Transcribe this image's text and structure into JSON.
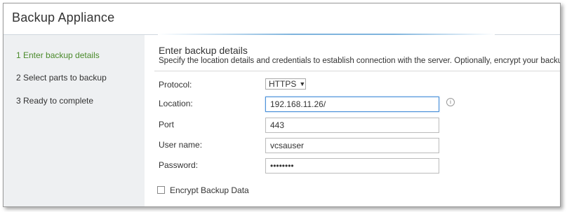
{
  "window": {
    "title": "Backup Appliance"
  },
  "sidebar": {
    "steps": [
      {
        "label": "1 Enter backup details",
        "active": true
      },
      {
        "label": "2 Select parts to backup",
        "active": false
      },
      {
        "label": "3 Ready to complete",
        "active": false
      }
    ]
  },
  "form": {
    "heading": "Enter backup details",
    "description": "Specify the location details and credentials to establish connection with the server. Optionally, encrypt your backup.",
    "protocol": {
      "label": "Protocol:",
      "value": "HTTPS"
    },
    "location": {
      "label": "Location:",
      "value": "192.168.11.26/"
    },
    "port": {
      "label": "Port",
      "value": "443"
    },
    "username": {
      "label": "User name:",
      "value": "vcsauser"
    },
    "password": {
      "label": "Password:",
      "value": "••••••••"
    },
    "encrypt": {
      "label": "Encrypt Backup Data",
      "checked": false
    },
    "info_icon": "info-icon"
  },
  "colors": {
    "active_step": "#4a8a2b",
    "sidebar_bg": "#eef0f2",
    "focus_border": "#4a90d9"
  }
}
